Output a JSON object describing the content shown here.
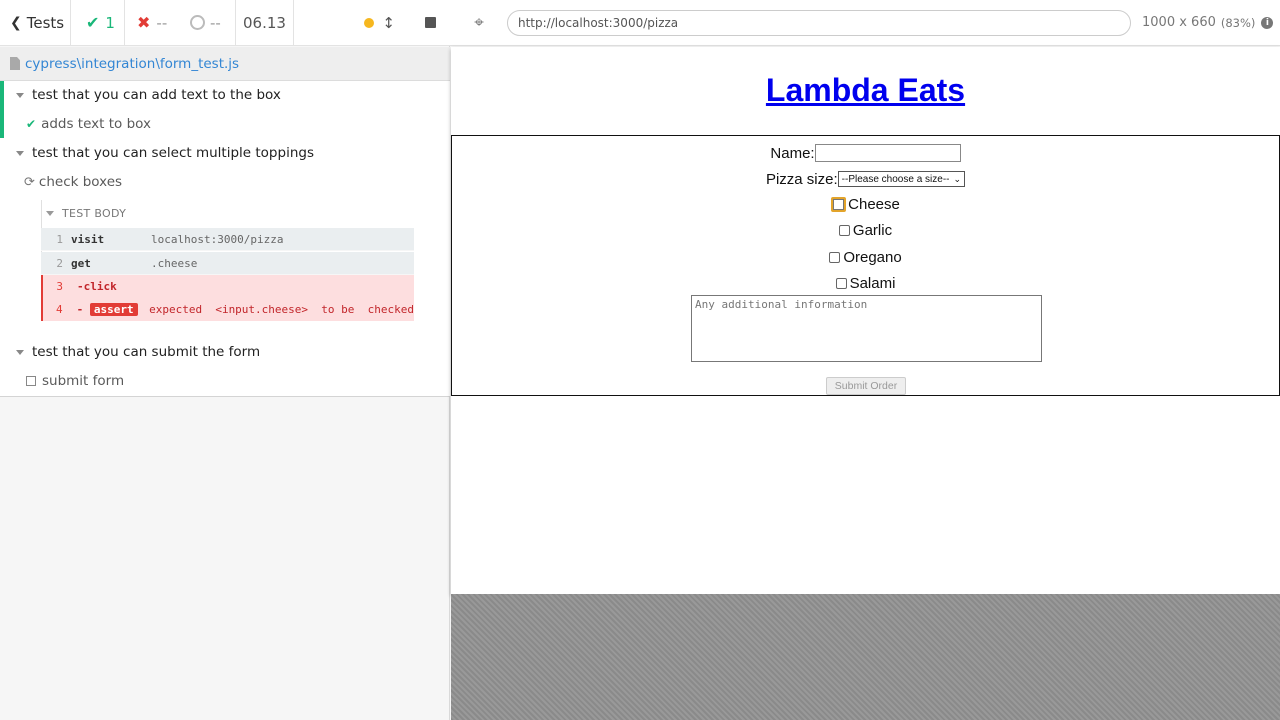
{
  "reporter": {
    "tests_label": "Tests",
    "passed": "1",
    "failed": "--",
    "pending": "--",
    "duration": "06.13",
    "spec_file": "cypress\\integration\\form_test.js",
    "suites": [
      {
        "title": "test that you can add text to the box",
        "tests": [
          {
            "title": "adds text to box",
            "state": "passed"
          }
        ]
      },
      {
        "title": "test that you can select multiple toppings",
        "tests": [
          {
            "title": "check boxes",
            "state": "running"
          }
        ]
      },
      {
        "title": "test that you can submit the form",
        "tests": [
          {
            "title": "submit form",
            "state": "pending"
          }
        ]
      }
    ],
    "test_body_label": "TEST BODY",
    "commands": [
      {
        "num": "1",
        "name": "visit",
        "message": "localhost:3000/pizza"
      },
      {
        "num": "2",
        "name": "get",
        "message": ".cheese"
      },
      {
        "num": "3",
        "name": "-click",
        "message": ""
      },
      {
        "num": "4",
        "name": "-",
        "badge": "assert",
        "message": "expected  <input.cheese>  to be  checked"
      }
    ]
  },
  "aut": {
    "url": "http://localhost:3000/pizza",
    "viewport": "1000 x 660",
    "scale": "(83%)",
    "app": {
      "title": "Lambda Eats",
      "name_label": "Name:",
      "size_label": "Pizza size:",
      "size_selected": "--Please choose a size--",
      "toppings": [
        "Cheese",
        "Garlic",
        "Oregano",
        "Salami"
      ],
      "notes_placeholder": "Any additional information",
      "submit_label": "Submit Order"
    }
  },
  "colors": {
    "pass": "#1ab779",
    "fail": "#e23c36",
    "link": "#0000ee",
    "spec_link": "#3386d4"
  }
}
